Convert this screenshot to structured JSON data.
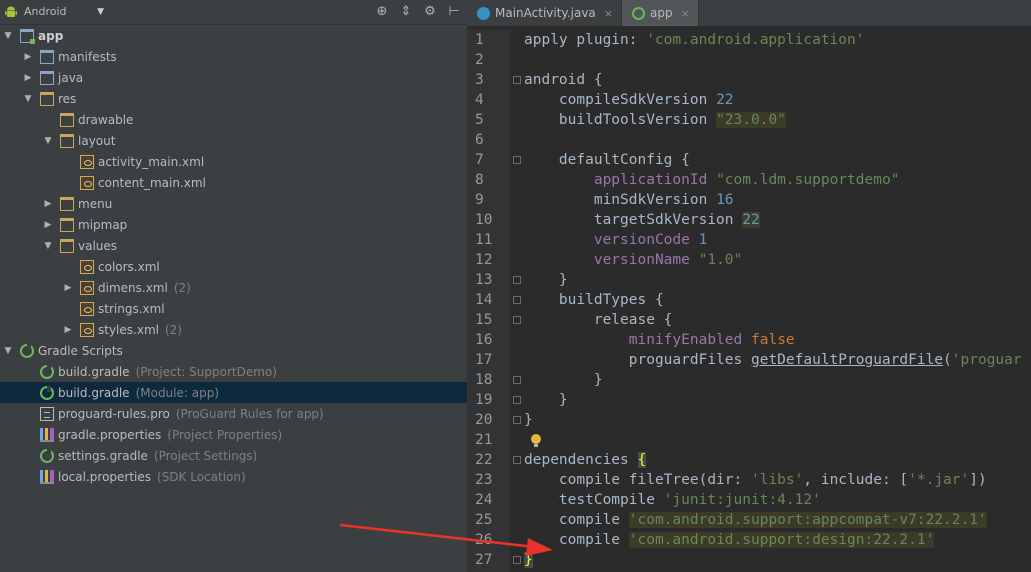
{
  "project_panel": {
    "view_selector": "Android",
    "tree": [
      {
        "label": "app",
        "indent": 0,
        "toggle": "down",
        "icon": "module",
        "bold": true
      },
      {
        "label": "manifests",
        "indent": 1,
        "toggle": "right",
        "icon": "folder"
      },
      {
        "label": "java",
        "indent": 1,
        "toggle": "right",
        "icon": "folder"
      },
      {
        "label": "res",
        "indent": 1,
        "toggle": "down",
        "icon": "res-folder"
      },
      {
        "label": "drawable",
        "indent": 2,
        "toggle": "",
        "icon": "res-folder"
      },
      {
        "label": "layout",
        "indent": 2,
        "toggle": "down",
        "icon": "res-folder"
      },
      {
        "label": "activity_main.xml",
        "indent": 3,
        "toggle": "",
        "icon": "xml"
      },
      {
        "label": "content_main.xml",
        "indent": 3,
        "toggle": "",
        "icon": "xml"
      },
      {
        "label": "menu",
        "indent": 2,
        "toggle": "right",
        "icon": "res-folder"
      },
      {
        "label": "mipmap",
        "indent": 2,
        "toggle": "right",
        "icon": "res-folder"
      },
      {
        "label": "values",
        "indent": 2,
        "toggle": "down",
        "icon": "res-folder"
      },
      {
        "label": "colors.xml",
        "indent": 3,
        "toggle": "",
        "icon": "xml"
      },
      {
        "label": "dimens.xml",
        "indent": 3,
        "toggle": "right",
        "icon": "xml",
        "hint": "(2)"
      },
      {
        "label": "strings.xml",
        "indent": 3,
        "toggle": "",
        "icon": "xml"
      },
      {
        "label": "styles.xml",
        "indent": 3,
        "toggle": "right",
        "icon": "xml",
        "hint": "(2)"
      },
      {
        "label": "Gradle Scripts",
        "indent": 0,
        "toggle": "down",
        "icon": "gradle"
      },
      {
        "label": "build.gradle",
        "indent": 1,
        "toggle": "",
        "icon": "gradle",
        "hint": "(Project: SupportDemo)"
      },
      {
        "label": "build.gradle",
        "indent": 1,
        "toggle": "",
        "icon": "gradle",
        "hint": "(Module: app)",
        "selected": true
      },
      {
        "label": "proguard-rules.pro",
        "indent": 1,
        "toggle": "",
        "icon": "text",
        "hint": "(ProGuard Rules for app)"
      },
      {
        "label": "gradle.properties",
        "indent": 1,
        "toggle": "",
        "icon": "props",
        "hint": "(Project Properties)"
      },
      {
        "label": "settings.gradle",
        "indent": 1,
        "toggle": "",
        "icon": "gradle",
        "hint": "(Project Settings)"
      },
      {
        "label": "local.properties",
        "indent": 1,
        "toggle": "",
        "icon": "props",
        "hint": "(SDK Location)"
      }
    ]
  },
  "tabs": [
    {
      "label": "MainActivity.java",
      "icon": "java",
      "active": false,
      "close": "×"
    },
    {
      "label": "app",
      "icon": "gradle",
      "active": true,
      "close": "×"
    }
  ],
  "code_lines": [
    {
      "n": "1",
      "fold": false,
      "segs": [
        [
          "apply plugin: ",
          "kw"
        ],
        [
          "'com.android.application'",
          "str"
        ]
      ]
    },
    {
      "n": "2",
      "fold": false,
      "segs": []
    },
    {
      "n": "3",
      "fold": true,
      "segs": [
        [
          "android {",
          "kw"
        ]
      ]
    },
    {
      "n": "4",
      "fold": false,
      "segs": [
        [
          "    compileSdkVersion ",
          "kw"
        ],
        [
          "22",
          "num-v"
        ]
      ]
    },
    {
      "n": "5",
      "fold": false,
      "segs": [
        [
          "    buildToolsVersion ",
          "kw"
        ],
        [
          "\"23.0.0\"",
          "hl-str"
        ]
      ]
    },
    {
      "n": "6",
      "fold": false,
      "segs": []
    },
    {
      "n": "7",
      "fold": true,
      "segs": [
        [
          "    defaultConfig {",
          "kw"
        ]
      ]
    },
    {
      "n": "8",
      "fold": false,
      "segs": [
        [
          "        ",
          "kw"
        ],
        [
          "applicationId",
          "prop"
        ],
        [
          " ",
          "kw"
        ],
        [
          "\"com.ldm.supportdemo\"",
          "str"
        ]
      ]
    },
    {
      "n": "9",
      "fold": false,
      "segs": [
        [
          "        minSdkVersion ",
          "kw"
        ],
        [
          "16",
          "num-v"
        ]
      ]
    },
    {
      "n": "10",
      "fold": false,
      "segs": [
        [
          "        targetSdkVersion ",
          "kw"
        ],
        [
          "22",
          "num-v hl"
        ]
      ]
    },
    {
      "n": "11",
      "fold": false,
      "segs": [
        [
          "        ",
          "kw"
        ],
        [
          "versionCode",
          "prop"
        ],
        [
          " ",
          "kw"
        ],
        [
          "1",
          "num-v"
        ]
      ]
    },
    {
      "n": "12",
      "fold": false,
      "segs": [
        [
          "        ",
          "kw"
        ],
        [
          "versionName",
          "prop"
        ],
        [
          " ",
          "kw"
        ],
        [
          "\"1.0\"",
          "str"
        ]
      ]
    },
    {
      "n": "13",
      "fold": true,
      "segs": [
        [
          "    }",
          "kw"
        ]
      ]
    },
    {
      "n": "14",
      "fold": true,
      "segs": [
        [
          "    buildTypes {",
          "kw"
        ]
      ]
    },
    {
      "n": "15",
      "fold": true,
      "segs": [
        [
          "        release {",
          "kw"
        ]
      ]
    },
    {
      "n": "16",
      "fold": false,
      "segs": [
        [
          "            ",
          "kw"
        ],
        [
          "minifyEnabled",
          "prop"
        ],
        [
          " ",
          "kw"
        ],
        [
          "false",
          "kw-or"
        ]
      ]
    },
    {
      "n": "17",
      "fold": false,
      "segs": [
        [
          "            proguardFiles ",
          "kw"
        ],
        [
          "getDefaultProguardFile",
          "ul"
        ],
        [
          "(",
          "kw"
        ],
        [
          "'proguar",
          "str"
        ]
      ]
    },
    {
      "n": "18",
      "fold": true,
      "segs": [
        [
          "        }",
          "kw"
        ]
      ]
    },
    {
      "n": "19",
      "fold": true,
      "segs": [
        [
          "    }",
          "kw"
        ]
      ]
    },
    {
      "n": "20",
      "fold": true,
      "segs": [
        [
          "}",
          "kw"
        ]
      ]
    },
    {
      "n": "21",
      "fold": false,
      "bulb": true,
      "segs": []
    },
    {
      "n": "22",
      "fold": true,
      "segs": [
        [
          "dependencies ",
          "kw"
        ],
        [
          "{",
          "brace-hl"
        ]
      ]
    },
    {
      "n": "23",
      "fold": false,
      "segs": [
        [
          "    compile fileTree(dir: ",
          "kw"
        ],
        [
          "'libs'",
          "str"
        ],
        [
          ", include: [",
          "kw"
        ],
        [
          "'*.jar'",
          "str"
        ],
        [
          "])",
          "kw"
        ]
      ]
    },
    {
      "n": "24",
      "fold": false,
      "segs": [
        [
          "    testCompile ",
          "kw"
        ],
        [
          "'junit:junit:4.12'",
          "str"
        ]
      ]
    },
    {
      "n": "25",
      "fold": false,
      "segs": [
        [
          "    compile ",
          "kw"
        ],
        [
          "'com.android.support:appcompat-v7:22.2.1'",
          "hl-str"
        ]
      ]
    },
    {
      "n": "26",
      "fold": false,
      "segs": [
        [
          "    compile ",
          "kw"
        ],
        [
          "'com.android.support:design:22.2.1'",
          "hl-str"
        ]
      ]
    },
    {
      "n": "27",
      "fold": true,
      "segs": [
        [
          "}",
          "brace-hl"
        ]
      ]
    }
  ],
  "colors": {
    "annotation_arrow": "#e8332a",
    "editor_bg": "#2b2b2b",
    "panel_bg": "#3c3f41",
    "selection": "#0d293e"
  }
}
